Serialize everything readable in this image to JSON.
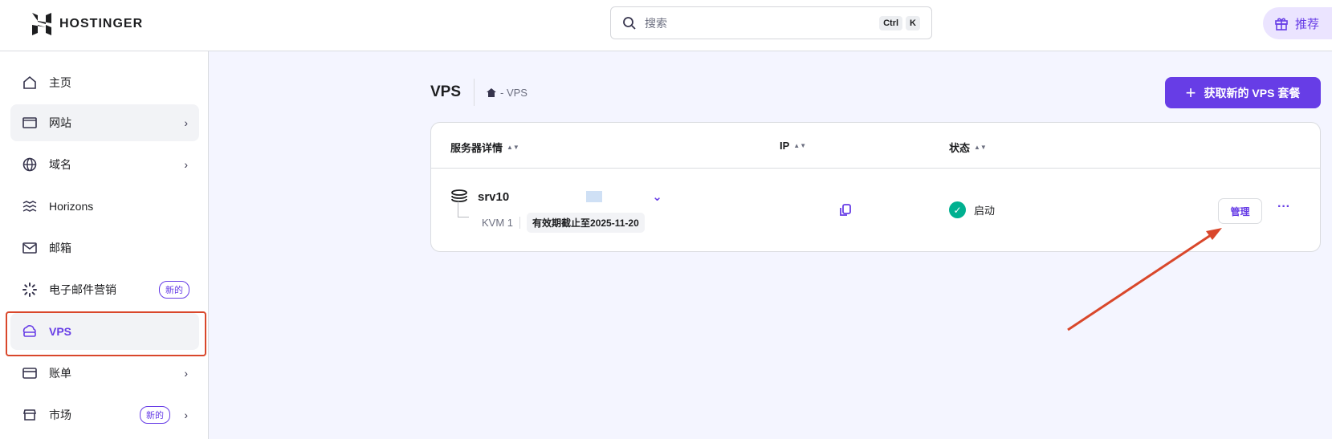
{
  "header": {
    "brand": "HOSTINGER",
    "search_placeholder": "搜索",
    "shortcut": [
      "Ctrl",
      "K"
    ],
    "referral": "推荐"
  },
  "sidebar": {
    "items": [
      {
        "label": "主页",
        "icon": "home-icon"
      },
      {
        "label": "网站",
        "icon": "browser-icon",
        "chevron": true
      },
      {
        "label": "域名",
        "icon": "globe-icon",
        "chevron": true
      },
      {
        "label": "Horizons",
        "icon": "waves-icon"
      },
      {
        "label": "邮箱",
        "icon": "mail-icon"
      },
      {
        "label": "电子邮件营销",
        "icon": "loader-icon",
        "badge": "新的"
      },
      {
        "label": "VPS",
        "icon": "server-icon",
        "active": true
      },
      {
        "label": "账单",
        "icon": "card-icon",
        "chevron": true
      },
      {
        "label": "市场",
        "icon": "store-icon",
        "chevron": true,
        "badge": "新的"
      }
    ]
  },
  "main": {
    "title": "VPS",
    "breadcrumb": "- VPS",
    "new_button": "获取新的 VPS 套餐",
    "table": {
      "columns": [
        "服务器详情",
        "IP",
        "状态"
      ],
      "rows": [
        {
          "name": "srv10",
          "plan": "KVM 1",
          "expiry": "有效期截止至2025-11-20",
          "status": "启动",
          "manage": "管理",
          "more": "···"
        }
      ]
    }
  },
  "colors": {
    "accent": "#673de6",
    "success": "#00b090",
    "annotation": "#d9472b"
  }
}
